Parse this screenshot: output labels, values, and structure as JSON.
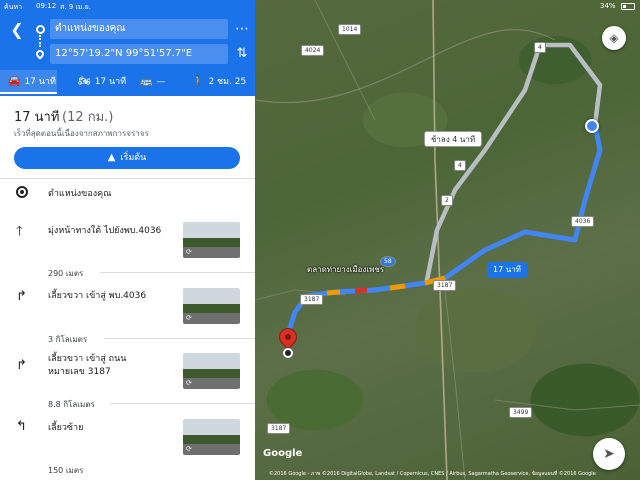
{
  "status_bar": {
    "carrier": "ค้นหา",
    "time": "09:12",
    "date": "ส. 9 เม.ย.",
    "battery": "34%"
  },
  "search": {
    "origin": "ตำแหน่งของคุณ",
    "destination": "12°57'19.2\"N 99°51'57.7\"E"
  },
  "modes": [
    {
      "icon": "car-icon",
      "label": "17 นาที",
      "selected": true
    },
    {
      "icon": "motorcycle-icon",
      "label": "17 นาที",
      "selected": false
    },
    {
      "icon": "transit-icon",
      "label": "—",
      "selected": false
    },
    {
      "icon": "walk-icon",
      "label": "2 ชม. 25",
      "selected": false
    }
  ],
  "summary": {
    "duration": "17 นาที",
    "distance": "(12 กม.)",
    "note": "เร็วที่สุดตอนนี้เนื่องจากสภาพการจราจร",
    "start_label": "เริ่มต้น"
  },
  "steps": [
    {
      "icon": "origin-icon",
      "text": "ตำแหน่งของคุณ",
      "distance": ""
    },
    {
      "icon": "straight-arrow-icon",
      "text": "มุ่งหน้าทางใต้ ไปยังพบ.4036",
      "distance": "290 เมตร"
    },
    {
      "icon": "turn-right-icon",
      "text": "เลี้ยวขวา เข้าสู่ พบ.4036",
      "distance": "3 กิโลเมตร"
    },
    {
      "icon": "turn-right-icon",
      "text1": "เลี้ยวขวา เข้าสู่ ถนน",
      "text2": "หมายเลข 3187",
      "distance": "8.8 กิโลเมตร"
    },
    {
      "icon": "turn-left-icon",
      "text": "เลี้ยวซ้าย",
      "distance": "150 เมตร"
    }
  ],
  "map": {
    "route_badge_main": "17 นาที",
    "route_badge_alt": "ช้าลง 4 นาที",
    "town_label": "ตลาดท่ายางเมืองเพชร",
    "road_shields": [
      "1014",
      "4024",
      "4",
      "4036",
      "2",
      "4",
      "3187",
      "3187",
      "3187",
      "3499",
      "58"
    ],
    "google": "Google",
    "copyright": "©2016 Google - ภาพ ©2016 DigitalGlobe, Landsat / Copernicus, CNES / Airbus, Sagarmatha Geoservice, ข้อมูลแผนที่ ©2016 Google"
  },
  "colors": {
    "header_blue": "#1a73e8",
    "route_blue": "#4285f4",
    "alt_route": "#b9bec4",
    "traffic_orange": "#f29900",
    "destination_red": "#d93025"
  }
}
